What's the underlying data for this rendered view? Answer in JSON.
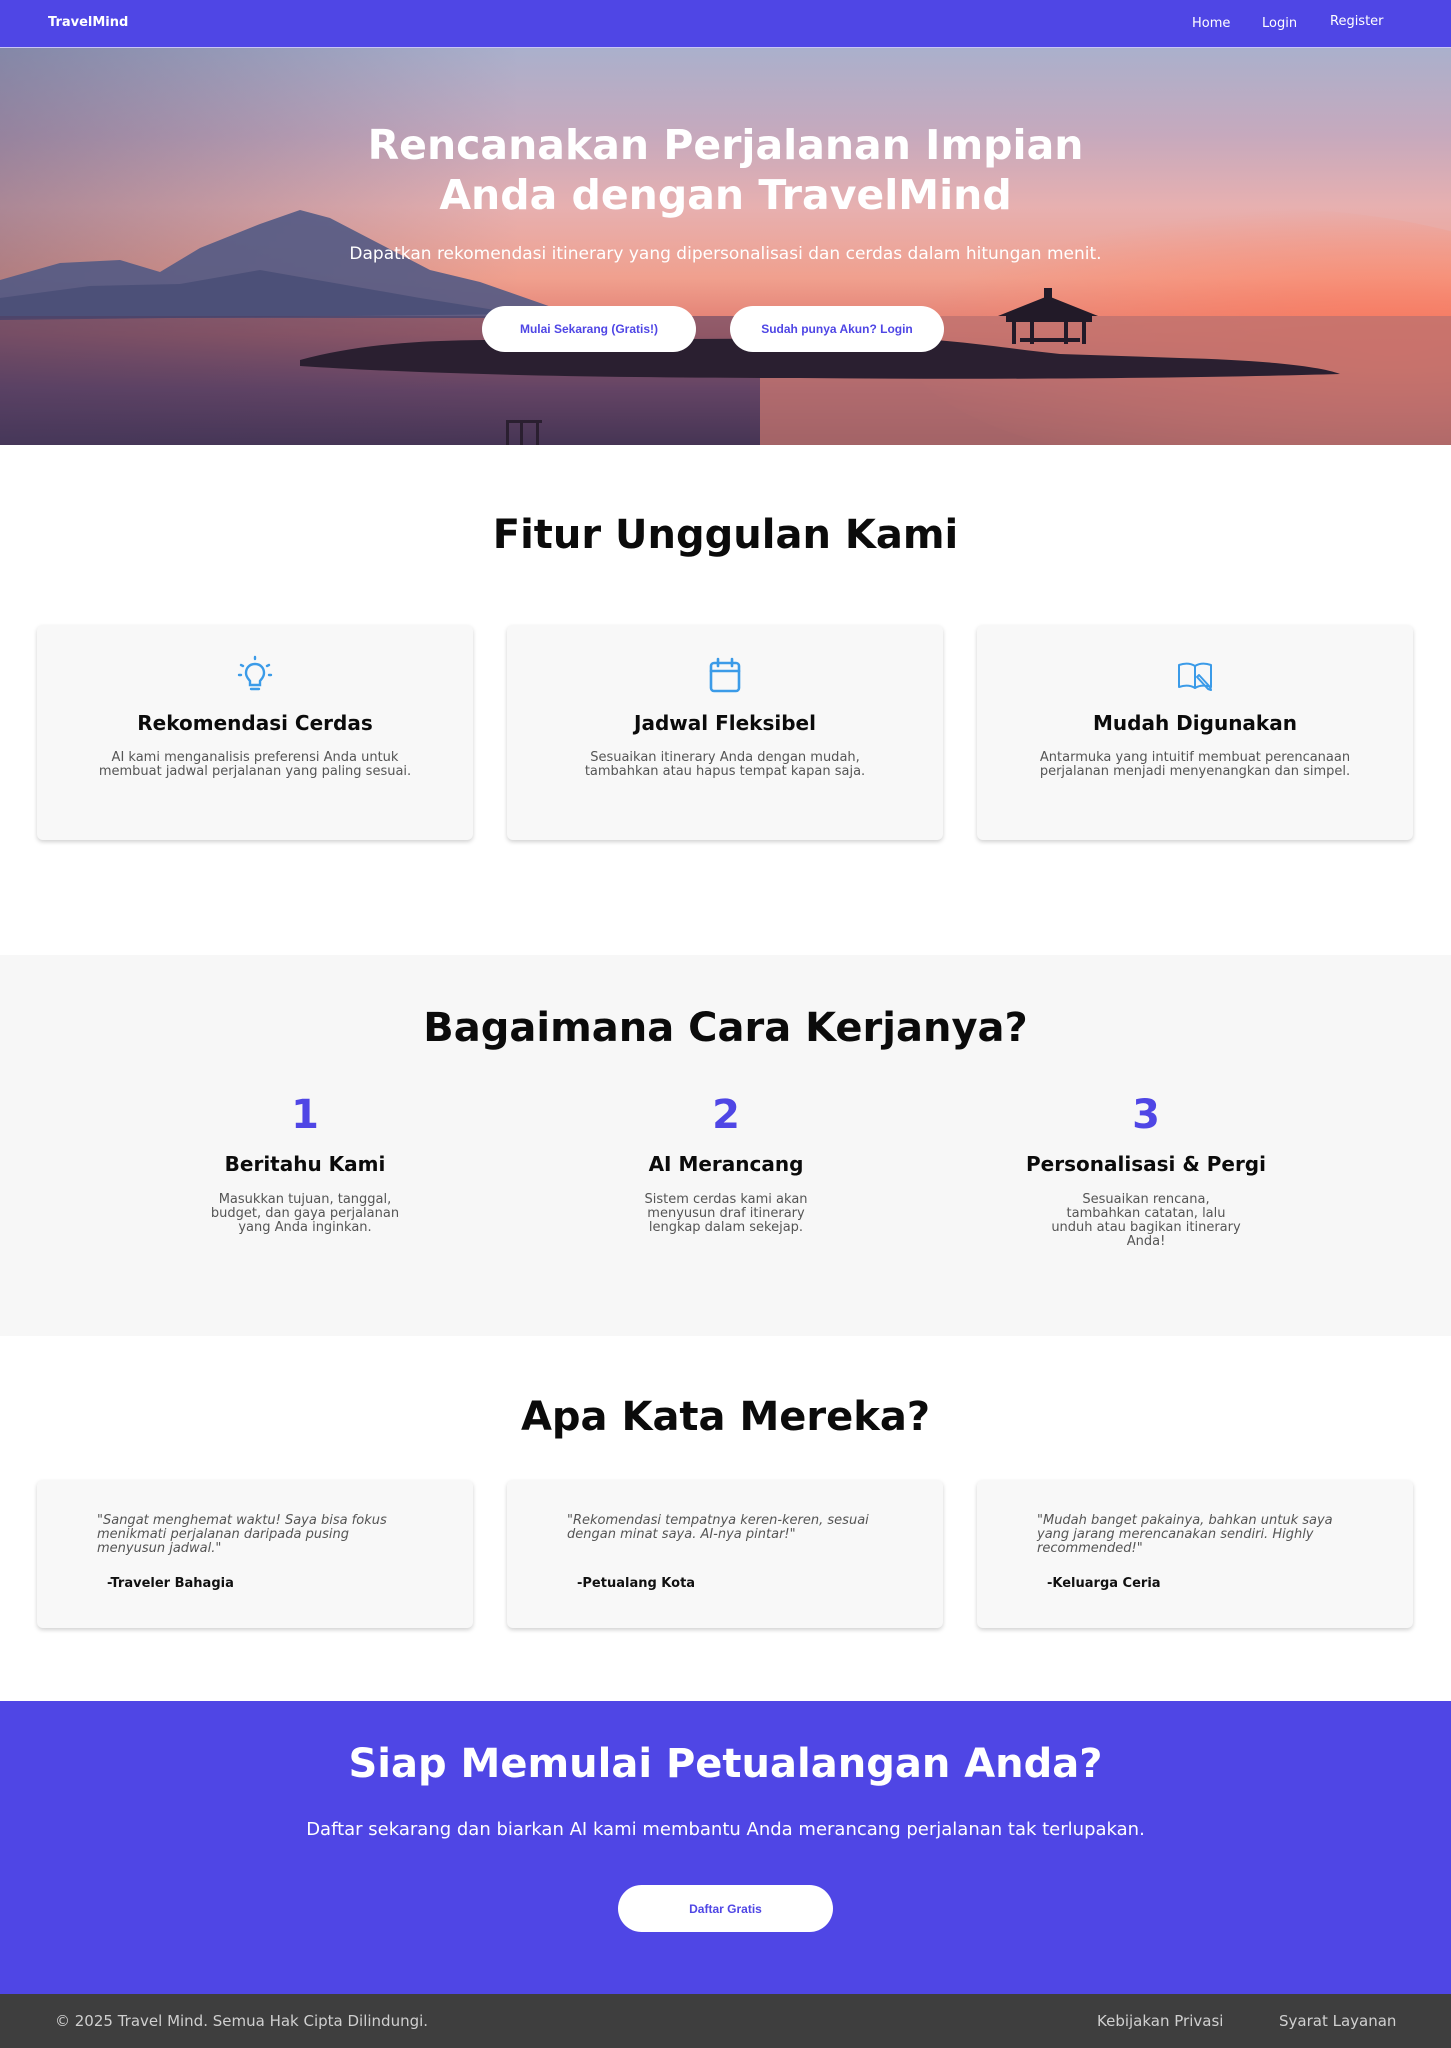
{
  "navbar": {
    "brand": "TravelMind",
    "links": {
      "home": "Home",
      "login": "Login",
      "register": "Register"
    }
  },
  "hero": {
    "title": "Rencanakan Perjalanan Impian Anda dengan TravelMind",
    "subtitle": "Dapatkan rekomendasi itinerary yang dipersonalisasi dan cerdas dalam hitungan menit.",
    "primary_button": "Mulai  Sekarang (Gratis!)",
    "secondary_button": "Sudah punya Akun? Login"
  },
  "features": {
    "title": "Fitur Unggulan Kami",
    "items": [
      {
        "icon": "lightbulb-icon",
        "title": "Rekomendasi Cerdas",
        "desc": "AI kami menganalisis preferensi Anda untuk membuat jadwal perjalanan yang paling sesuai."
      },
      {
        "icon": "calendar-icon",
        "title": "Jadwal Fleksibel",
        "desc": "Sesuaikan itinerary Anda dengan mudah, tambahkan atau hapus tempat kapan saja."
      },
      {
        "icon": "book-edit-icon",
        "title": "Mudah Digunakan",
        "desc": "Antarmuka yang intuitif membuat perencanaan perjalanan menjadi menyenangkan dan simpel."
      }
    ],
    "icon_color": "#3b9be8"
  },
  "how": {
    "title": "Bagaimana Cara Kerjanya?",
    "steps": [
      {
        "number": "1",
        "title": "Beritahu Kami",
        "desc": "Masukkan tujuan, tanggal, budget, dan gaya perjalanan yang Anda inginkan."
      },
      {
        "number": "2",
        "title": "AI Merancang",
        "desc": "Sistem cerdas kami akan menyusun draf itinerary lengkap dalam sekejap."
      },
      {
        "number": "3",
        "title": "Personalisasi & Pergi",
        "desc": "Sesuaikan rencana, tambahkan catatan, lalu unduh atau bagikan itinerary Anda!"
      }
    ]
  },
  "testimonials": {
    "title": "Apa Kata Mereka?",
    "items": [
      {
        "quote": "\"Sangat menghemat waktu! Saya bisa fokus menikmati perjalanan daripada pusing menyusun jadwal.\"",
        "author": "-Traveler Bahagia"
      },
      {
        "quote": "\"Rekomendasi tempatnya keren-keren, sesuai dengan minat saya. AI-nya pintar!\"",
        "author": "-Petualang Kota"
      },
      {
        "quote": "\"Mudah banget pakainya, bahkan untuk saya yang jarang merencanakan sendiri. Highly recommended!\"",
        "author": "-Keluarga Ceria"
      }
    ]
  },
  "cta": {
    "title": "Siap Memulai Petualangan Anda?",
    "subtitle": "Daftar sekarang dan biarkan AI kami membantu Anda merancang perjalanan tak terlupakan.",
    "button": "Daftar Gratis"
  },
  "footer": {
    "copyright": "© 2025 Travel Mind. Semua Hak Cipta Dilindungi.",
    "privacy": "Kebijakan Privasi",
    "terms": "Syarat Layanan"
  },
  "colors": {
    "primary": "#4f46e5",
    "footer_bg": "#3e3e3e"
  }
}
